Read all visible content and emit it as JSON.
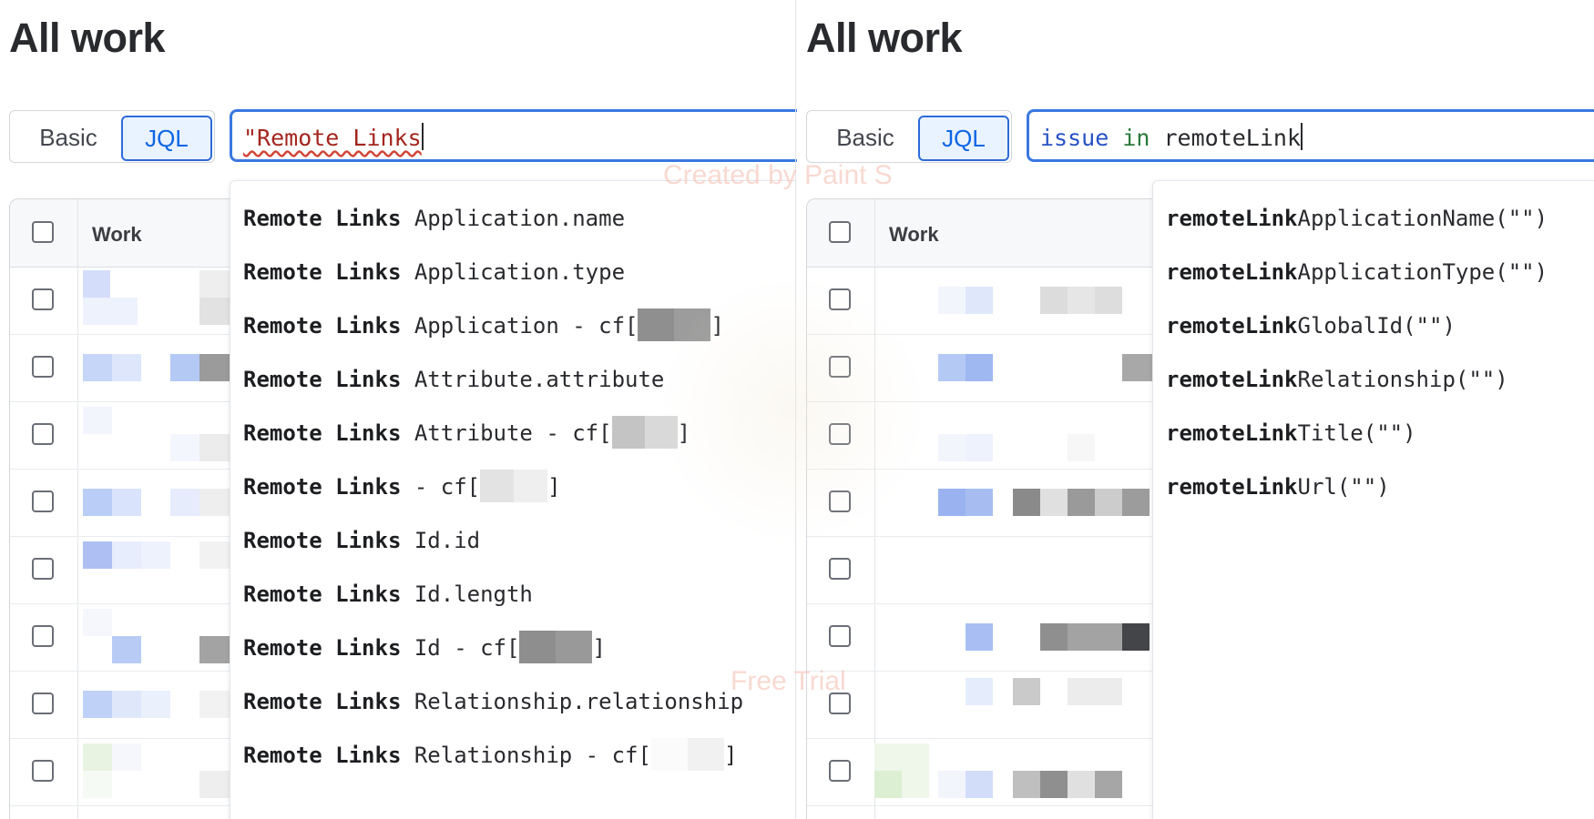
{
  "left": {
    "page_title": "All work",
    "toggle": {
      "basic": "Basic",
      "jql": "JQL"
    },
    "query": {
      "text": "\"Remote Links"
    },
    "column_work": "Work",
    "suggestions": [
      {
        "bold": "Remote Links",
        "rest": " Application.name"
      },
      {
        "bold": "Remote Links",
        "rest": " Application.type"
      },
      {
        "bold": "Remote Links",
        "rest": " Application - cf[",
        "tail": "]"
      },
      {
        "bold": "Remote Links",
        "rest": " Attribute.attribute"
      },
      {
        "bold": "Remote Links",
        "rest": " Attribute - cf[",
        "tail": "]"
      },
      {
        "bold": "Remote Links",
        "rest": " - cf[",
        "tail": "]"
      },
      {
        "bold": "Remote Links",
        "rest": " Id.id"
      },
      {
        "bold": "Remote Links",
        "rest": " Id.length"
      },
      {
        "bold": "Remote Links",
        "rest": " Id - cf[",
        "tail": "]"
      },
      {
        "bold": "Remote Links",
        "rest": " Relationship.relationship"
      },
      {
        "bold": "Remote Links",
        "rest": " Relationship - cf[",
        "tail": "]"
      }
    ]
  },
  "right": {
    "page_title": "All work",
    "toggle": {
      "basic": "Basic",
      "jql": "JQL"
    },
    "query": {
      "kw": "issue",
      "op": "in",
      "text": "remoteLink"
    },
    "column_work": "Work",
    "suggestions": [
      {
        "bold": "remoteLink",
        "rest": "ApplicationName(\"\")"
      },
      {
        "bold": "remoteLink",
        "rest": "ApplicationType(\"\")"
      },
      {
        "bold": "remoteLink",
        "rest": "GlobalId(\"\")"
      },
      {
        "bold": "remoteLink",
        "rest": "Relationship(\"\")"
      },
      {
        "bold": "remoteLink",
        "rest": "Title(\"\")"
      },
      {
        "bold": "remoteLink",
        "rest": "Url(\"\")"
      }
    ]
  },
  "watermark": {
    "top": "Created by Paint S",
    "bottom": "Free Trial"
  },
  "colors": {
    "accent": "#0c66e4",
    "focus_border": "#3a78e0",
    "string": "#a3261e",
    "keyword": "#2751c5",
    "operator": "#2a7a3a"
  }
}
